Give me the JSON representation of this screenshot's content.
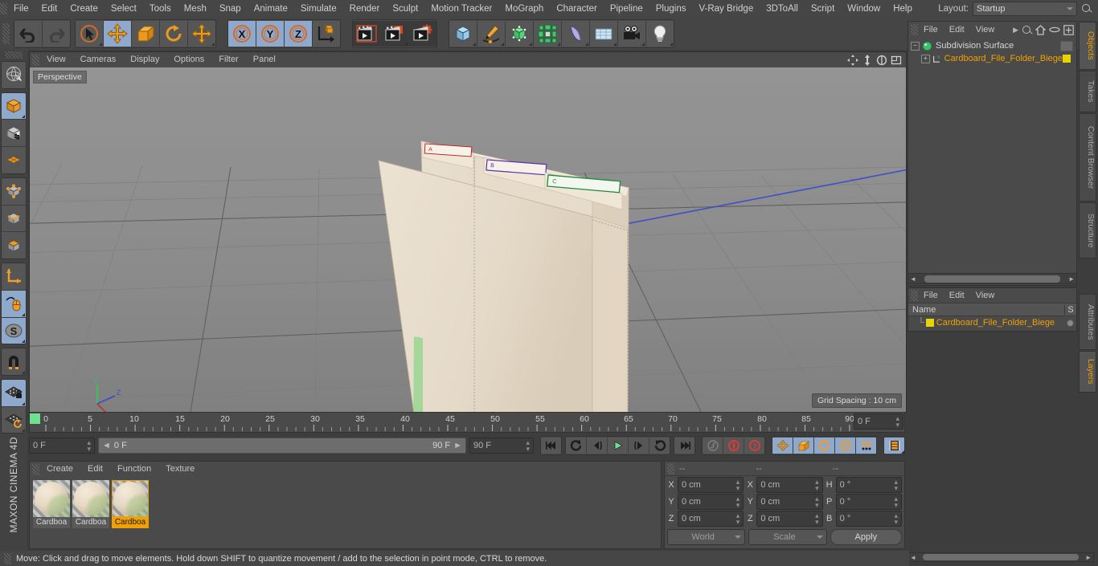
{
  "menubar": {
    "items": [
      "File",
      "Edit",
      "Create",
      "Select",
      "Tools",
      "Mesh",
      "Snap",
      "Animate",
      "Simulate",
      "Render",
      "Sculpt",
      "Motion Tracker",
      "MoGraph",
      "Character",
      "Pipeline",
      "Plugins",
      "V-Ray Bridge",
      "3DToAll",
      "Script",
      "Window",
      "Help"
    ],
    "layout_label": "Layout:",
    "layout_value": "Startup",
    "search_icon": "search-icon"
  },
  "toolbar": {
    "groups": [
      {
        "name": "undo-redo",
        "buttons": [
          {
            "icon": "undo-icon",
            "label": "Undo",
            "active": false
          },
          {
            "icon": "redo-icon",
            "label": "Redo",
            "active": false
          }
        ]
      },
      {
        "name": "transform-tools",
        "buttons": [
          {
            "icon": "select-live-icon",
            "label": "Live Selection",
            "active": false
          },
          {
            "icon": "move-icon",
            "label": "Move",
            "active": true
          },
          {
            "icon": "scale-icon",
            "label": "Scale",
            "active": false
          },
          {
            "icon": "rotate-icon",
            "label": "Rotate",
            "active": false
          },
          {
            "icon": "move-alt-icon",
            "label": "Move (alt)",
            "active": false
          }
        ]
      },
      {
        "name": "axis-locks",
        "buttons": [
          {
            "icon": "axis-x-icon",
            "label": "X",
            "active": true
          },
          {
            "icon": "axis-y-icon",
            "label": "Y",
            "active": true
          },
          {
            "icon": "axis-z-icon",
            "label": "Z",
            "active": true
          },
          {
            "icon": "world-object-axis-icon",
            "label": "World/Object",
            "active": false
          }
        ]
      },
      {
        "name": "render-tools",
        "buttons": [
          {
            "icon": "render-view-icon",
            "label": "Render View",
            "active": false
          },
          {
            "icon": "render-picture-viewer-icon",
            "label": "Render to Picture Viewer",
            "active": false
          },
          {
            "icon": "render-settings-icon",
            "label": "Edit Render Settings",
            "active": false
          }
        ]
      },
      {
        "name": "create-objects",
        "buttons": [
          {
            "icon": "cube-primitive-icon",
            "label": "Add Cube Object",
            "active": false
          },
          {
            "icon": "spline-pen-icon",
            "label": "Add Spline Object",
            "active": false
          },
          {
            "icon": "nurbs-icon",
            "label": "Add Generator Object",
            "active": false
          },
          {
            "icon": "array-icon",
            "label": "Add Modeling Object",
            "active": false
          },
          {
            "icon": "deformer-icon",
            "label": "Add Bend Object",
            "active": false
          },
          {
            "icon": "environment-icon",
            "label": "Add Scene Object",
            "active": false
          },
          {
            "icon": "camera-icon",
            "label": "Add Camera Object",
            "active": false
          },
          {
            "icon": "light-icon",
            "label": "Add Light Object",
            "active": false
          }
        ]
      }
    ]
  },
  "left_toolbar": {
    "groups": [
      {
        "buttons": [
          {
            "icon": "make-editable-icon",
            "active": false
          }
        ]
      },
      {
        "buttons": [
          {
            "icon": "model-mode-icon",
            "active": true
          },
          {
            "icon": "texture-mode-icon",
            "active": false
          },
          {
            "icon": "workplane-mode-icon",
            "active": false
          }
        ]
      },
      {
        "buttons": [
          {
            "icon": "points-mode-icon",
            "active": false
          },
          {
            "icon": "edges-mode-icon",
            "active": false
          },
          {
            "icon": "polygons-mode-icon",
            "active": false
          }
        ]
      },
      {
        "buttons": [
          {
            "icon": "object-axis-mode-icon",
            "active": false
          },
          {
            "icon": "viewport-solo-icon",
            "active": true
          },
          {
            "icon": "enable-snapping-icon",
            "active": true
          }
        ]
      },
      {
        "buttons": [
          {
            "icon": "magnet-icon",
            "active": false
          }
        ]
      },
      {
        "buttons": [
          {
            "icon": "lock-workplane-icon",
            "active": true
          },
          {
            "icon": "planar-workplane-icon",
            "active": false
          }
        ]
      }
    ],
    "brand_top": "MAXON",
    "brand_bottom": "CINEMA 4D"
  },
  "viewport": {
    "menu": [
      "View",
      "Cameras",
      "Display",
      "Options",
      "Filter",
      "Panel"
    ],
    "view_label": "Perspective",
    "grid_spacing": "Grid Spacing : 10 cm",
    "axis_labels": {
      "x": "X",
      "y": "Y",
      "z": "Z"
    },
    "icons": [
      "pan-icon",
      "dolly-icon",
      "orbit-icon",
      "maximize-icon"
    ],
    "scene": {
      "object": "Cardboard File Folder Biege",
      "folder_tabs": [
        {
          "label": "A",
          "color": "#c02020"
        },
        {
          "label": "B",
          "color": "#5b2fa8"
        },
        {
          "label": "C",
          "color": "#1f8a3c"
        }
      ],
      "body_color": "#e8ddcc",
      "edge_highlight_color": "#8fd48a",
      "background_color": "#8b8b8b"
    }
  },
  "timeline": {
    "tick_labels": [
      "0",
      "5",
      "10",
      "15",
      "20",
      "25",
      "30",
      "35",
      "40",
      "45",
      "50",
      "55",
      "60",
      "65",
      "70",
      "75",
      "80",
      "85",
      "90"
    ],
    "range_start": 0,
    "range_end": 90,
    "current_frame_field": "0 F",
    "start_field": "0 F",
    "scrub_left": "0 F",
    "scrub_right": "90 F",
    "end_field": "90 F",
    "transport": [
      {
        "icon": "go-to-start-icon",
        "active": false
      },
      {
        "icon": "previous-key-icon",
        "active": false
      },
      {
        "icon": "step-back-icon",
        "active": false
      },
      {
        "icon": "play-icon",
        "active": false
      },
      {
        "icon": "step-forward-icon",
        "active": false
      },
      {
        "icon": "next-key-icon",
        "active": false
      },
      {
        "icon": "go-to-end-icon",
        "active": false
      }
    ],
    "record_tools": [
      {
        "icon": "autokey-icon",
        "active": false
      },
      {
        "icon": "record-active-objects-icon",
        "active": false
      },
      {
        "icon": "keyframe-selection-icon",
        "active": false
      }
    ],
    "key_tools": [
      {
        "icon": "record-position-icon",
        "active": true
      },
      {
        "icon": "record-scale-icon",
        "active": true
      },
      {
        "icon": "record-rotation-icon",
        "active": true
      },
      {
        "icon": "record-parameter-icon",
        "active": true
      },
      {
        "icon": "record-pla-icon",
        "active": true
      }
    ],
    "timeline_toggle": {
      "icon": "timeline-icon",
      "active": true
    }
  },
  "material_manager": {
    "menu": [
      "Create",
      "Edit",
      "Function",
      "Texture"
    ],
    "materials": [
      {
        "name": "Cardboa",
        "selected": false
      },
      {
        "name": "Cardboa",
        "selected": false
      },
      {
        "name": "Cardboa",
        "selected": true
      }
    ]
  },
  "coordinates": {
    "headers": [
      "--",
      "--",
      "--"
    ],
    "rows": [
      {
        "a1": "X",
        "v1": "0 cm",
        "a2": "X",
        "v2": "0 cm",
        "a3": "H",
        "v3": "0 °"
      },
      {
        "a1": "Y",
        "v1": "0 cm",
        "a2": "Y",
        "v2": "0 cm",
        "a3": "P",
        "v3": "0 °"
      },
      {
        "a1": "Z",
        "v1": "0 cm",
        "a2": "Z",
        "v2": "0 cm",
        "a3": "B",
        "v3": "0 °"
      }
    ],
    "space_combo": "World",
    "mode_combo": "Scale",
    "apply_label": "Apply"
  },
  "object_manager": {
    "menu": [
      "File",
      "Edit",
      "View"
    ],
    "icons": [
      "more-arrow-icon",
      "search-icon",
      "home-icon",
      "ellipse-icon",
      "plus-box-icon"
    ],
    "tree": [
      {
        "name": "Subdivision Surface",
        "icon": "subdivision-surface-icon",
        "depth": 0,
        "selected": false,
        "expander": "-"
      },
      {
        "name": "Cardboard_File_Folder_Biege",
        "icon": "polygon-object-icon",
        "depth": 1,
        "selected": true,
        "expander": "+",
        "tag_color": "#e8d400"
      }
    ]
  },
  "layer_manager": {
    "menu": [
      "File",
      "Edit",
      "View"
    ],
    "columns": [
      "Name",
      "S"
    ],
    "rows": [
      {
        "name": "Cardboard_File_Folder_Biege",
        "color": "#e8d400"
      }
    ]
  },
  "right_dock": {
    "top_tabs": [
      {
        "label": "Objects",
        "active": true
      },
      {
        "label": "Takes",
        "active": false
      },
      {
        "label": "Content Browser",
        "active": false
      },
      {
        "label": "Structure",
        "active": false
      }
    ],
    "bottom_tabs": [
      {
        "label": "Attributes",
        "active": false
      },
      {
        "label": "Layers",
        "active": true
      }
    ]
  },
  "status_bar": {
    "text": "Move: Click and drag to move elements. Hold down SHIFT to quantize movement / add to the selection in point mode, CTRL to remove."
  }
}
